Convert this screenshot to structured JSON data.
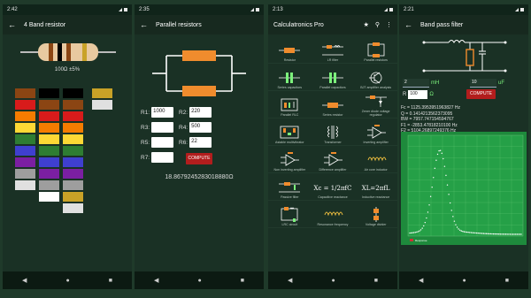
{
  "phones": [
    {
      "time": "2:42",
      "title": "4 Band resistor",
      "resistor_value": "100Ω ±5%",
      "band_colors": [
        "#8b4513",
        "#000000",
        "#8b4513",
        "#c9a227"
      ],
      "swatch_columns": [
        [
          "#8b4513",
          "#d81b1b",
          "#f57c00",
          "#fdd835",
          "#2e7d32",
          "#3f3fcf",
          "#7b1fa2",
          "#9e9e9e",
          "#e0e0e0"
        ],
        [
          "#000000",
          "#8b4513",
          "#d81b1b",
          "#f57c00",
          "#fdd835",
          "#2e7d32",
          "#3f3fcf",
          "#7b1fa2",
          "#9e9e9e",
          "#ffffff"
        ],
        [
          "#000000",
          "#8b4513",
          "#d81b1b",
          "#f57c00",
          "#fdd835",
          "#2e7d32",
          "#3f3fcf",
          "#7b1fa2",
          "#9e9e9e",
          "#c9a227",
          "#e0e0e0"
        ],
        [
          "#c9a227",
          "#e0e0e0"
        ]
      ]
    },
    {
      "time": "2:35",
      "title": "Parallel resistors",
      "fields": [
        {
          "label": "R1:",
          "value": "1000"
        },
        {
          "label": "R2:",
          "value": "220"
        },
        {
          "label": "R3:",
          "value": ""
        },
        {
          "label": "R4:",
          "value": "500"
        },
        {
          "label": "R5:",
          "value": ""
        },
        {
          "label": "R6:",
          "value": "22"
        },
        {
          "label": "R7:",
          "value": ""
        }
      ],
      "compute_label": "COMPUTE",
      "result": "18.8679245283018880Ω"
    },
    {
      "time": "2:13",
      "title": "Calculatronics Pro",
      "menu": [
        "Resistor",
        "LR filter",
        "Parallel resistors",
        "Series capacitors",
        "Parallel capacitors",
        "BJT amplifier analysis",
        "Parallel RLC",
        "Series resistor",
        "Zener diode voltage regulator",
        "Astable multivibrator",
        "Transformer",
        "Inverting amplifier",
        "Non inverting amplifier",
        "Difference amplifier",
        "Air core inductor",
        "Passive filter",
        "Capacitive reactance",
        "Inductive reactance",
        "LRC circuit",
        "Resonance frequency",
        "Voltage divider"
      ],
      "xc_formula": "Xc = 1/2πfC",
      "xl_formula": "XL=2πfL"
    },
    {
      "time": "2:21",
      "title": "Band pass filter",
      "l_value": "2",
      "l_unit": "mH",
      "c_value": "10",
      "c_unit": "uF",
      "r_label": "R",
      "r_value": "100",
      "r_unit": "Ω",
      "compute_label": "COMPUTE",
      "results": [
        "Fc = 1125.3953951963827 Hz",
        "Q = 0.1414213562373095",
        "BW = 7957.747154594767",
        "F1 = -2853.47818210100 Hz",
        "F2 = 5104.26897249376 Hz"
      ],
      "legend": "Response"
    }
  ],
  "nav": {
    "back": "◀",
    "home": "●",
    "recent": "■"
  }
}
